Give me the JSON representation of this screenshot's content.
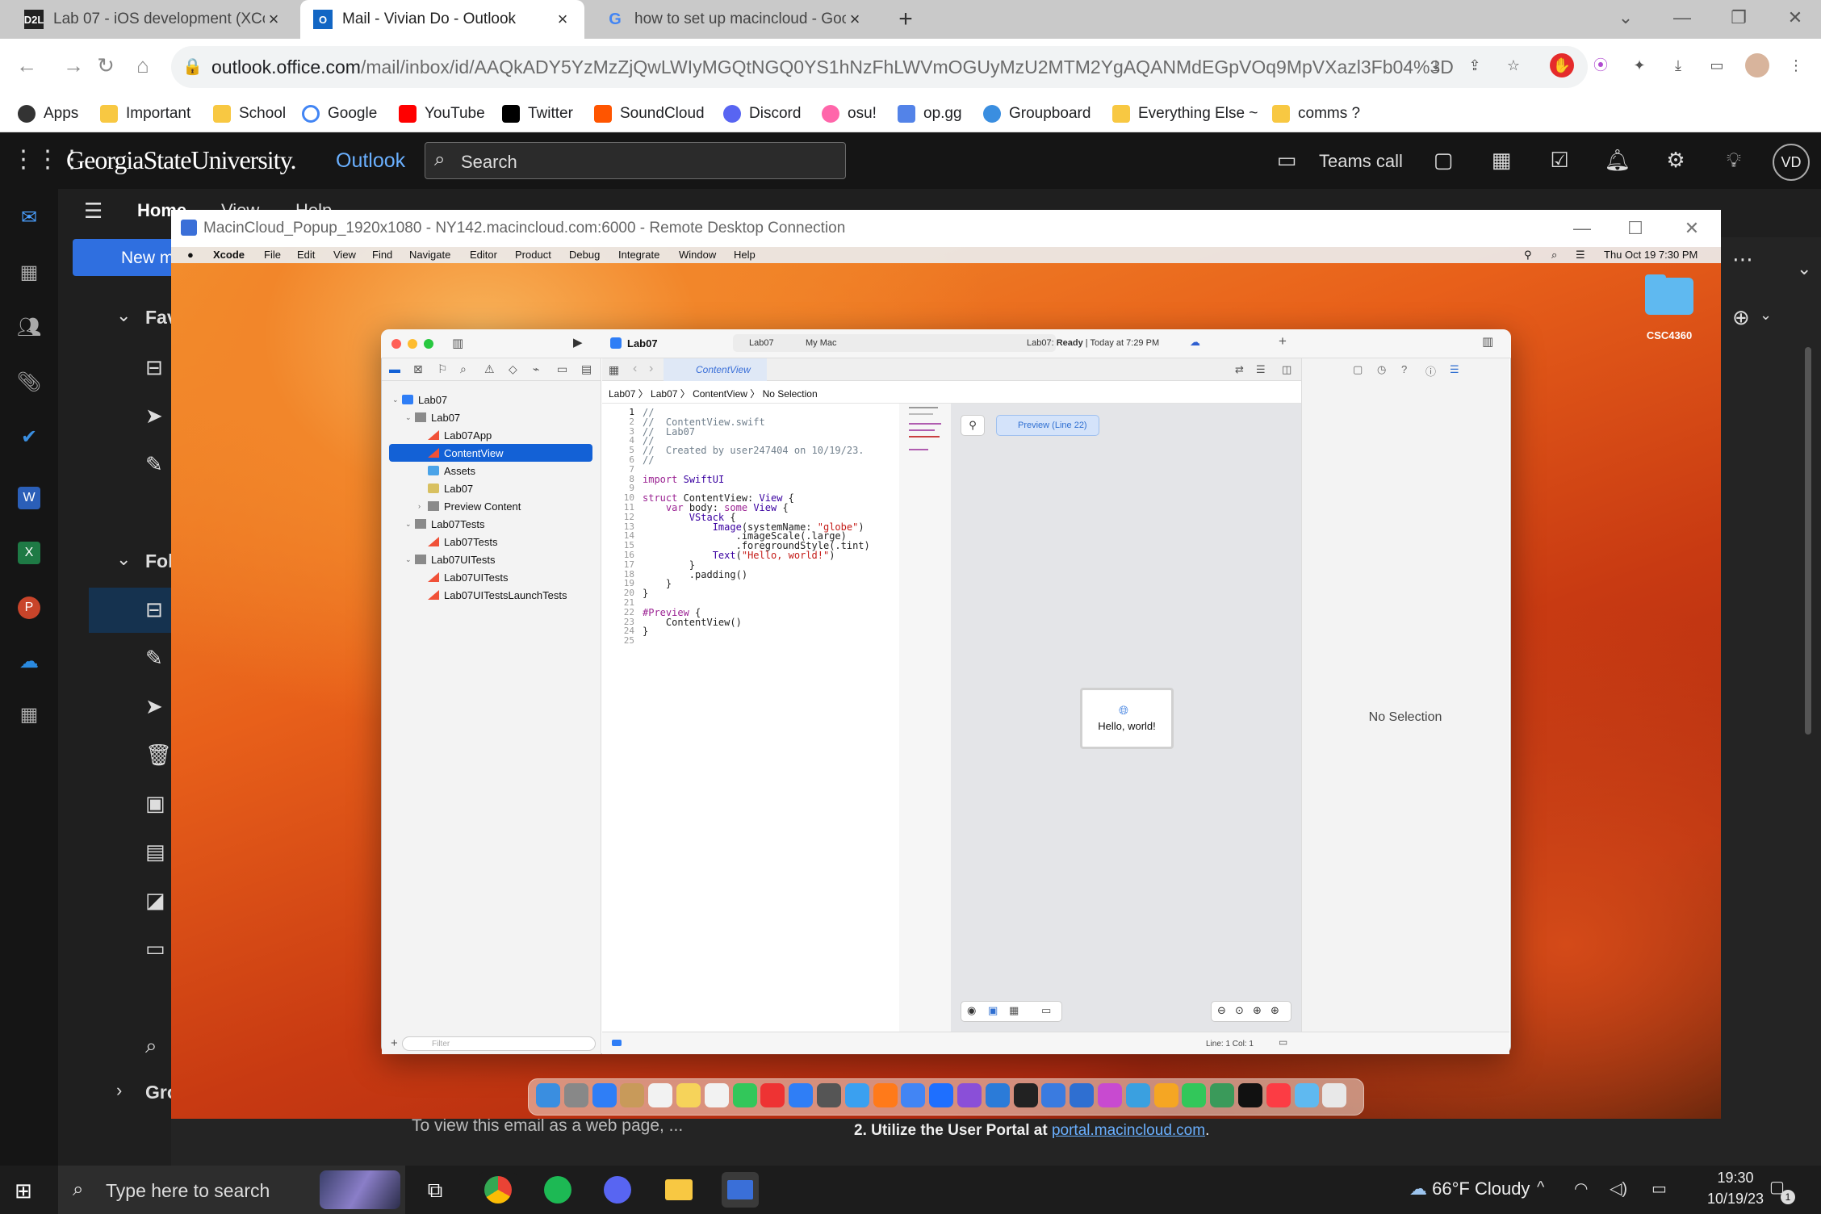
{
  "browser": {
    "tabs": [
      {
        "title": "Lab 07 - iOS development (XCo",
        "favicon": "D2L"
      },
      {
        "title": "Mail - Vivian Do - Outlook",
        "favicon": "O"
      },
      {
        "title": "how to set up macincloud - Goo",
        "favicon": "G"
      }
    ],
    "new_tab": "+",
    "url_host": "outlook.office.com",
    "url_path": "/mail/inbox/id/AAQkADY5YzMzZjQwLWIyMGQtNGQ0YS1hNzFhLWVmOGUyMzU2MTM2YgAQANMdEGpVOq9MpVXazl3Fb04%3D",
    "bookmarks": [
      "Apps",
      "Important",
      "School",
      "Google",
      "YouTube",
      "Twitter",
      "SoundCloud",
      "Discord",
      "osu!",
      "op.gg",
      "Groupboard",
      "Everything Else ~",
      "comms ?"
    ]
  },
  "outlook": {
    "org": "GeorgiaStateUniversity.",
    "app": "Outlook",
    "search_placeholder": "Search",
    "teams_call": "Teams call",
    "avatar": "VD",
    "tab_home": "Home",
    "tab_view": "View",
    "tab_help": "Help",
    "new_mail": "New m",
    "favorites": "Fav",
    "folders": "Fol",
    "groups": "Gro",
    "preview_text": "To view this email as a web page, ...",
    "body_step": "2. Utilize the User Portal at ",
    "body_link": "portal.macincloud.com",
    "body_end": "."
  },
  "rdp": {
    "title": "MacinCloud_Popup_1920x1080 - NY142.macincloud.com:6000 - Remote Desktop Connection"
  },
  "mac": {
    "menu": [
      "Xcode",
      "File",
      "Edit",
      "View",
      "Find",
      "Navigate",
      "Editor",
      "Product",
      "Debug",
      "Integrate",
      "Window",
      "Help"
    ],
    "datetime": "Thu Oct 19  7:30 PM",
    "desktop_folder": "CSC4360"
  },
  "xcode": {
    "project": "Lab07",
    "scheme": "Lab07",
    "destination": "My Mac",
    "status_prefix": "Lab07: ",
    "status_bold": "Ready",
    "status_suffix": " | Today at 7:29 PM",
    "editor_tab": "ContentView",
    "jumpbar": [
      "Lab07",
      "Lab07",
      "ContentView",
      "No Selection"
    ],
    "tree": [
      {
        "label": "Lab07",
        "icon": "xproj",
        "indent": 0,
        "arrow": "v"
      },
      {
        "label": "Lab07",
        "icon": "folder",
        "indent": 1,
        "arrow": "v"
      },
      {
        "label": "Lab07App",
        "icon": "swift",
        "indent": 2,
        "arrow": ""
      },
      {
        "label": "ContentView",
        "icon": "swift",
        "indent": 2,
        "arrow": "",
        "selected": true
      },
      {
        "label": "Assets",
        "icon": "asset",
        "indent": 2,
        "arrow": ""
      },
      {
        "label": "Lab07",
        "icon": "plist",
        "indent": 2,
        "arrow": ""
      },
      {
        "label": "Preview Content",
        "icon": "folder",
        "indent": 2,
        "arrow": ">"
      },
      {
        "label": "Lab07Tests",
        "icon": "folder",
        "indent": 1,
        "arrow": "v"
      },
      {
        "label": "Lab07Tests",
        "icon": "swift",
        "indent": 2,
        "arrow": ""
      },
      {
        "label": "Lab07UITests",
        "icon": "folder",
        "indent": 1,
        "arrow": "v"
      },
      {
        "label": "Lab07UITests",
        "icon": "swift",
        "indent": 2,
        "arrow": ""
      },
      {
        "label": "Lab07UITestsLaunchTests",
        "icon": "swift",
        "indent": 2,
        "arrow": ""
      }
    ],
    "code_lines": [
      "//",
      "//  ContentView.swift",
      "//  Lab07",
      "//",
      "//  Created by user247404 on 10/19/23.",
      "//",
      "",
      "import SwiftUI",
      "",
      "struct ContentView: View {",
      "    var body: some View {",
      "        VStack {",
      "            Image(systemName: \"globe\")",
      "                .imageScale(.large)",
      "                .foregroundStyle(.tint)",
      "            Text(\"Hello, world!\")",
      "        }",
      "        .padding()",
      "    }",
      "}",
      "",
      "#Preview {",
      "    ContentView()",
      "}",
      ""
    ],
    "preview_label": "Preview (Line 22)",
    "preview_text": "Hello, world!",
    "inspector_empty": "No Selection",
    "filter_placeholder": "Filter",
    "cursor": "Line: 1  Col: 1"
  },
  "taskbar": {
    "search_placeholder": "Type here to search",
    "weather": "66°F  Cloudy",
    "time": "19:30",
    "date": "10/19/23",
    "notifications": "1"
  }
}
